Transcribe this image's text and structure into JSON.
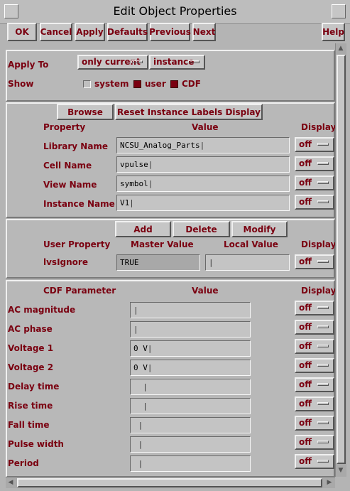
{
  "window": {
    "title": "Edit Object Properties"
  },
  "toolbar": [
    "OK",
    "Cancel",
    "Apply",
    "Defaults",
    "Previous",
    "Next",
    "Help"
  ],
  "apply_to": {
    "label": "Apply To",
    "scope": "only current",
    "object": "instance"
  },
  "show": {
    "label": "Show",
    "options": [
      {
        "label": "system",
        "checked": false
      },
      {
        "label": "user",
        "checked": true
      },
      {
        "label": "CDF",
        "checked": true
      }
    ]
  },
  "props": {
    "browse": "Browse",
    "reset": "Reset Instance Labels Display",
    "headers": {
      "property": "Property",
      "value": "Value",
      "display": "Display"
    },
    "rows": [
      {
        "label": "Library Name",
        "value": "NCSU_Analog_Parts",
        "display": "off"
      },
      {
        "label": "Cell Name",
        "value": "vpulse",
        "display": "off"
      },
      {
        "label": "View Name",
        "value": "symbol",
        "display": "off"
      },
      {
        "label": "Instance Name",
        "value": "V1",
        "display": "off"
      }
    ]
  },
  "user": {
    "add": "Add",
    "delete": "Delete",
    "modify": "Modify",
    "headers": {
      "property": "User Property",
      "master": "Master Value",
      "local": "Local Value",
      "display": "Display"
    },
    "rows": [
      {
        "label": "lvsIgnore",
        "master": "TRUE",
        "local": "",
        "display": "off"
      }
    ]
  },
  "cdf": {
    "headers": {
      "param": "CDF Parameter",
      "value": "Value",
      "display": "Display"
    },
    "rows": [
      {
        "label": "AC magnitude",
        "value": "",
        "display": "off"
      },
      {
        "label": "AC phase",
        "value": "",
        "display": "off"
      },
      {
        "label": "Voltage 1",
        "value": "0 V",
        "display": "off"
      },
      {
        "label": "Voltage 2",
        "value": "0 V",
        "display": "off"
      },
      {
        "label": "Delay time",
        "value": "",
        "display": "off"
      },
      {
        "label": "Rise time",
        "value": "",
        "display": "off"
      },
      {
        "label": "Fall time",
        "value": "",
        "display": "off"
      },
      {
        "label": "Pulse width",
        "value": "",
        "display": "off"
      },
      {
        "label": "Period",
        "value": "",
        "display": "off"
      }
    ]
  }
}
